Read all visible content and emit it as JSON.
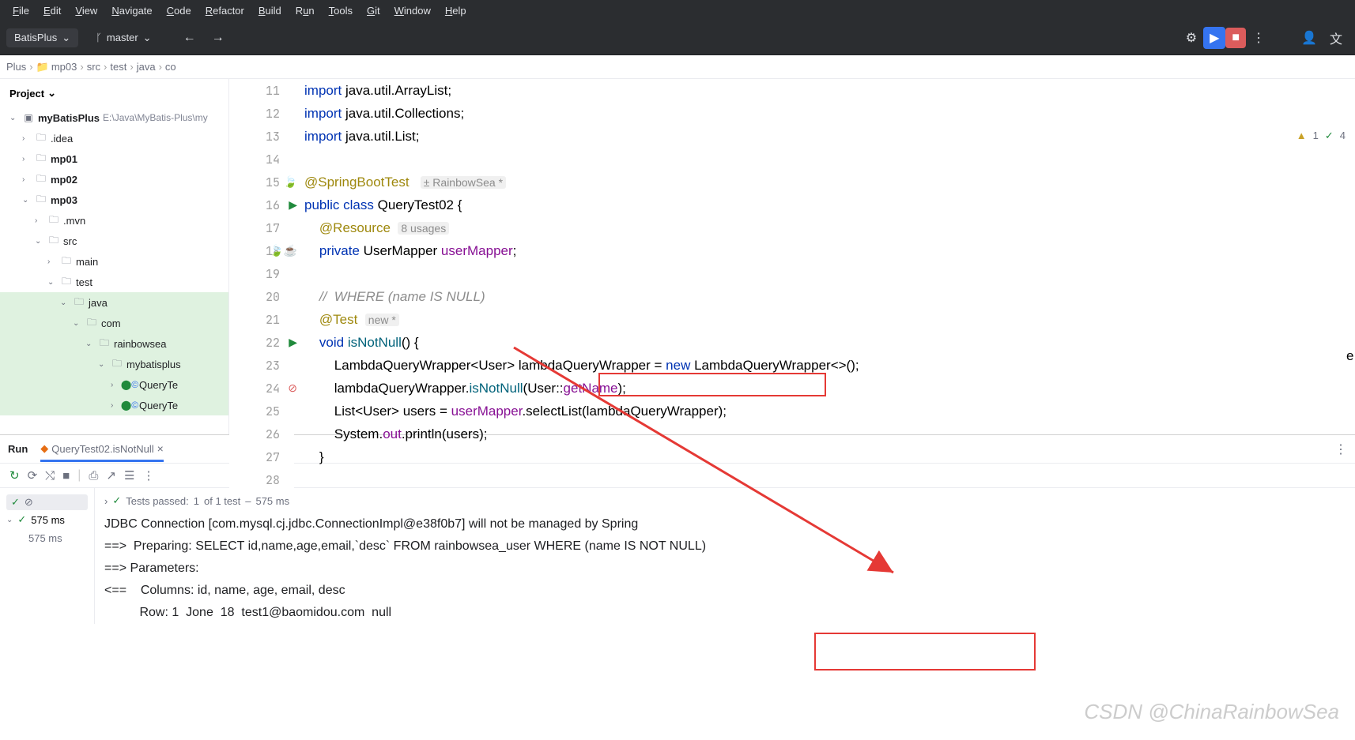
{
  "menubar": [
    "File",
    "Edit",
    "View",
    "Navigate",
    "Code",
    "Refactor",
    "Build",
    "Run",
    "Tools",
    "Git",
    "Window",
    "Help"
  ],
  "toolbar": {
    "project": "BatisPlus",
    "branch": "master"
  },
  "breadcrumb": [
    "Plus",
    "mp03",
    "src",
    "test",
    "java",
    "co"
  ],
  "sidebar": {
    "title": "Project",
    "root": {
      "name": "myBatisPlus",
      "path": "E:\\Java\\MyBatis-Plus\\my"
    },
    "items": [
      {
        "l": ".idea",
        "i": 1,
        "exp": false
      },
      {
        "l": "mp01",
        "i": 1,
        "exp": false,
        "bold": true
      },
      {
        "l": "mp02",
        "i": 1,
        "exp": false,
        "bold": true
      },
      {
        "l": "mp03",
        "i": 1,
        "exp": true,
        "bold": true
      },
      {
        "l": ".mvn",
        "i": 2,
        "exp": false
      },
      {
        "l": "src",
        "i": 2,
        "exp": true
      },
      {
        "l": "main",
        "i": 3,
        "exp": false
      },
      {
        "l": "test",
        "i": 3,
        "exp": true
      },
      {
        "l": "java",
        "i": 4,
        "exp": true,
        "sel": true
      },
      {
        "l": "com",
        "i": 5,
        "exp": true,
        "sel": true
      },
      {
        "l": "rainbowsea",
        "i": 6,
        "exp": true,
        "sel": true
      },
      {
        "l": "mybatisplus",
        "i": 7,
        "exp": true,
        "sel": true
      },
      {
        "l": "QueryTe",
        "i": 8,
        "cls": true,
        "sel": true
      },
      {
        "l": "QueryTe",
        "i": 8,
        "cls": true,
        "sel": true
      }
    ]
  },
  "editor": {
    "lines": [
      {
        "n": 11,
        "html": "<span class='kw'>import</span> java.util.ArrayList;"
      },
      {
        "n": 12,
        "html": "<span class='kw'>import</span> java.util.Collections;"
      },
      {
        "n": 13,
        "html": "<span class='kw'>import</span> java.util.List;"
      },
      {
        "n": 14,
        "html": ""
      },
      {
        "n": 15,
        "html": "<span class='anno'>@SpringBootTest</span>   <span class='hint'>± RainbowSea *</span>",
        "icon": "leaf"
      },
      {
        "n": 16,
        "html": "<span class='kw'>public class</span> <span class='type'>QueryTest02</span> {",
        "icon": "run"
      },
      {
        "n": 17,
        "html": "    <span class='anno'>@Resource</span>  <span class='hint'>8 usages</span>"
      },
      {
        "n": 18,
        "html": "    <span class='kw'>private</span> UserMapper <span class='fld'>userMapper</span>;",
        "icon": "bean"
      },
      {
        "n": 19,
        "html": ""
      },
      {
        "n": 20,
        "html": "    <span class='comment'>//  WHERE (name IS NULL)</span>"
      },
      {
        "n": 21,
        "html": "    <span class='anno'>@Test</span>  <span class='hint'>new *</span>"
      },
      {
        "n": 22,
        "html": "    <span class='kw'>void</span> <span class='fn'>isNotNull</span>() {",
        "icon": "run"
      },
      {
        "n": 23,
        "html": "        LambdaQueryWrapper&lt;User&gt; lambdaQueryWrapper = <span class='kw'>new</span> LambdaQueryWrapper&lt;&gt;();"
      },
      {
        "n": 24,
        "html": "        lambdaQueryWrapper.<span class='fn'>isNotNull</span>(User::<span class='fld'>getName</span>);",
        "icon": "warn"
      },
      {
        "n": 25,
        "html": "        List&lt;User&gt; users = <span class='fld'>userMapper</span>.selectList(lambdaQueryWrapper);"
      },
      {
        "n": 26,
        "html": "        System.<span class='fld'>out</span>.println(users);"
      },
      {
        "n": 27,
        "html": "    }"
      },
      {
        "n": 28,
        "html": ""
      }
    ],
    "warnings": "1",
    "checks": "4",
    "overflow": "er<>();"
  },
  "run": {
    "tab1": "Run",
    "tab2": "QueryTest02.isNotNull",
    "testStatus": {
      "prefix": "Tests passed:",
      "count": "1",
      "of": "of 1 test",
      "time": "575 ms"
    },
    "leftTime": "575 ms",
    "leftTime2": "575 ms",
    "console": [
      "JDBC Connection [com.mysql.cj.jdbc.ConnectionImpl@e38f0b7] will not be managed by Spring",
      "==>  Preparing: SELECT id,name,age,email,`desc` FROM rainbowsea_user WHERE (name IS NOT NULL)",
      "==> Parameters:",
      "<==    Columns: id, name, age, email, desc",
      "          Row: 1  Jone  18  test1@baomidou.com  null"
    ]
  },
  "watermark": "CSDN @ChinaRainbowSea"
}
